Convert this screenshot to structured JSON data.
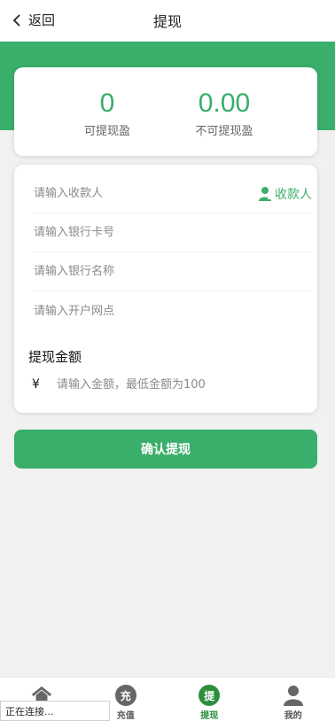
{
  "header": {
    "back_label": "返回",
    "title": "提现"
  },
  "balances": [
    {
      "value": "0",
      "label": "可提现盈"
    },
    {
      "value": "0.00",
      "label": "不可提现盈"
    }
  ],
  "form": {
    "payee_placeholder": "请输入收款人",
    "payee_link_label": "收款人",
    "card_placeholder": "请输入银行卡号",
    "bank_placeholder": "请输入银行名称",
    "branch_placeholder": "请输入开户网点",
    "amount_title": "提现金额",
    "currency_symbol": "¥",
    "amount_placeholder": "请输入金额，最低金额为100"
  },
  "confirm_label": "确认提现",
  "tabs": [
    {
      "label": "",
      "icon": "home-icon",
      "glyph": ""
    },
    {
      "label": "充值",
      "icon": "recharge-icon",
      "glyph": "充"
    },
    {
      "label": "提现",
      "icon": "withdraw-icon",
      "glyph": "提"
    },
    {
      "label": "我的",
      "icon": "user-icon",
      "glyph": ""
    }
  ],
  "status_text": "正在连接...",
  "colors": {
    "accent": "#3aae6b",
    "active_tab": "#2c8f3e",
    "inactive_icon": "#666666"
  }
}
